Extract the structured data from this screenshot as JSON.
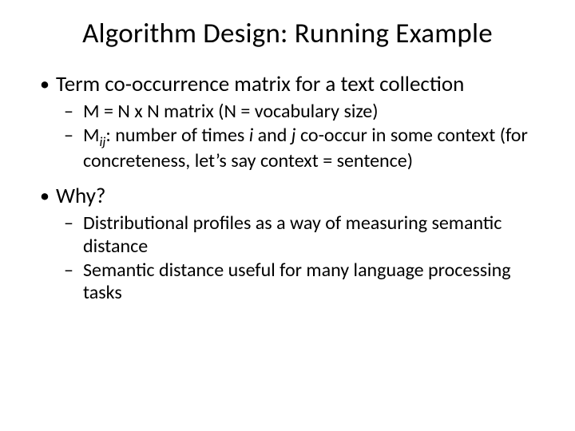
{
  "title": "Algorithm Design: Running Example",
  "bullets": {
    "b1": "Term co-occurrence matrix for a text collection",
    "b1_sub": {
      "s1": "M = N x N matrix (N = vocabulary size)",
      "s2_pre": "M",
      "s2_sub": "ij",
      "s2_mid1": ": number of times ",
      "s2_i": "i",
      "s2_mid2": " and ",
      "s2_j": "j",
      "s2_post": " co-occur in some context (for concreteness, let’s say context = sentence)"
    },
    "b2": "Why?",
    "b2_sub": {
      "s1": "Distributional profiles as a way of measuring semantic distance",
      "s2": "Semantic distance useful for many language processing tasks"
    }
  }
}
